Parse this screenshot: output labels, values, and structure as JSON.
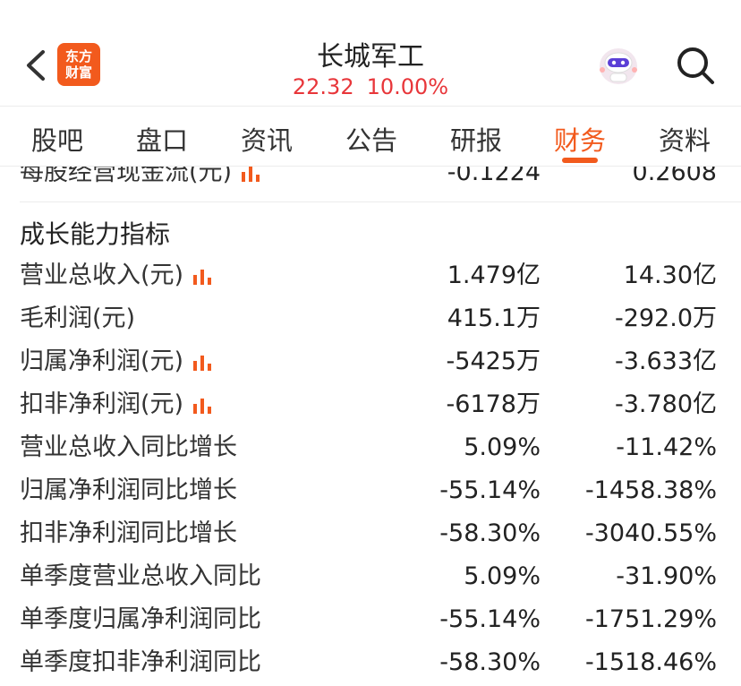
{
  "header": {
    "logo_line1": "东方",
    "logo_line2": "财富",
    "stock_name": "长城军工",
    "price": "22.32",
    "change_pct": "10.00%"
  },
  "tabs": [
    {
      "label": "股吧"
    },
    {
      "label": "盘口"
    },
    {
      "label": "资讯"
    },
    {
      "label": "公告"
    },
    {
      "label": "研报"
    },
    {
      "label": "财务",
      "active": true
    },
    {
      "label": "资料"
    }
  ],
  "partial_row": {
    "label": "每股经营现金流(元)",
    "v1": "-0.1224",
    "v2": "0.2608"
  },
  "section_title": "成长能力指标",
  "rows": [
    {
      "label": "营业总收入(元)",
      "v1": "1.479亿",
      "v2": "14.30亿",
      "has_chart": true
    },
    {
      "label": "毛利润(元)",
      "v1": "415.1万",
      "v2": "-292.0万",
      "has_chart": false
    },
    {
      "label": "归属净利润(元)",
      "v1": "-5425万",
      "v2": "-3.633亿",
      "has_chart": true
    },
    {
      "label": "扣非净利润(元)",
      "v1": "-6178万",
      "v2": "-3.780亿",
      "has_chart": true
    },
    {
      "label": "营业总收入同比增长",
      "v1": "5.09%",
      "v2": "-11.42%",
      "has_chart": false
    },
    {
      "label": "归属净利润同比增长",
      "v1": "-55.14%",
      "v2": "-1458.38%",
      "has_chart": false
    },
    {
      "label": "扣非净利润同比增长",
      "v1": "-58.30%",
      "v2": "-3040.55%",
      "has_chart": false
    },
    {
      "label": "单季度营业总收入同比",
      "v1": "5.09%",
      "v2": "-31.90%",
      "has_chart": false
    },
    {
      "label": "单季度归属净利润同比",
      "v1": "-55.14%",
      "v2": "-1751.29%",
      "has_chart": false
    },
    {
      "label": "单季度扣非净利润同比",
      "v1": "-58.30%",
      "v2": "-1518.46%",
      "has_chart": false
    }
  ],
  "colors": {
    "accent": "#f25a1d",
    "price": "#e8363a"
  }
}
